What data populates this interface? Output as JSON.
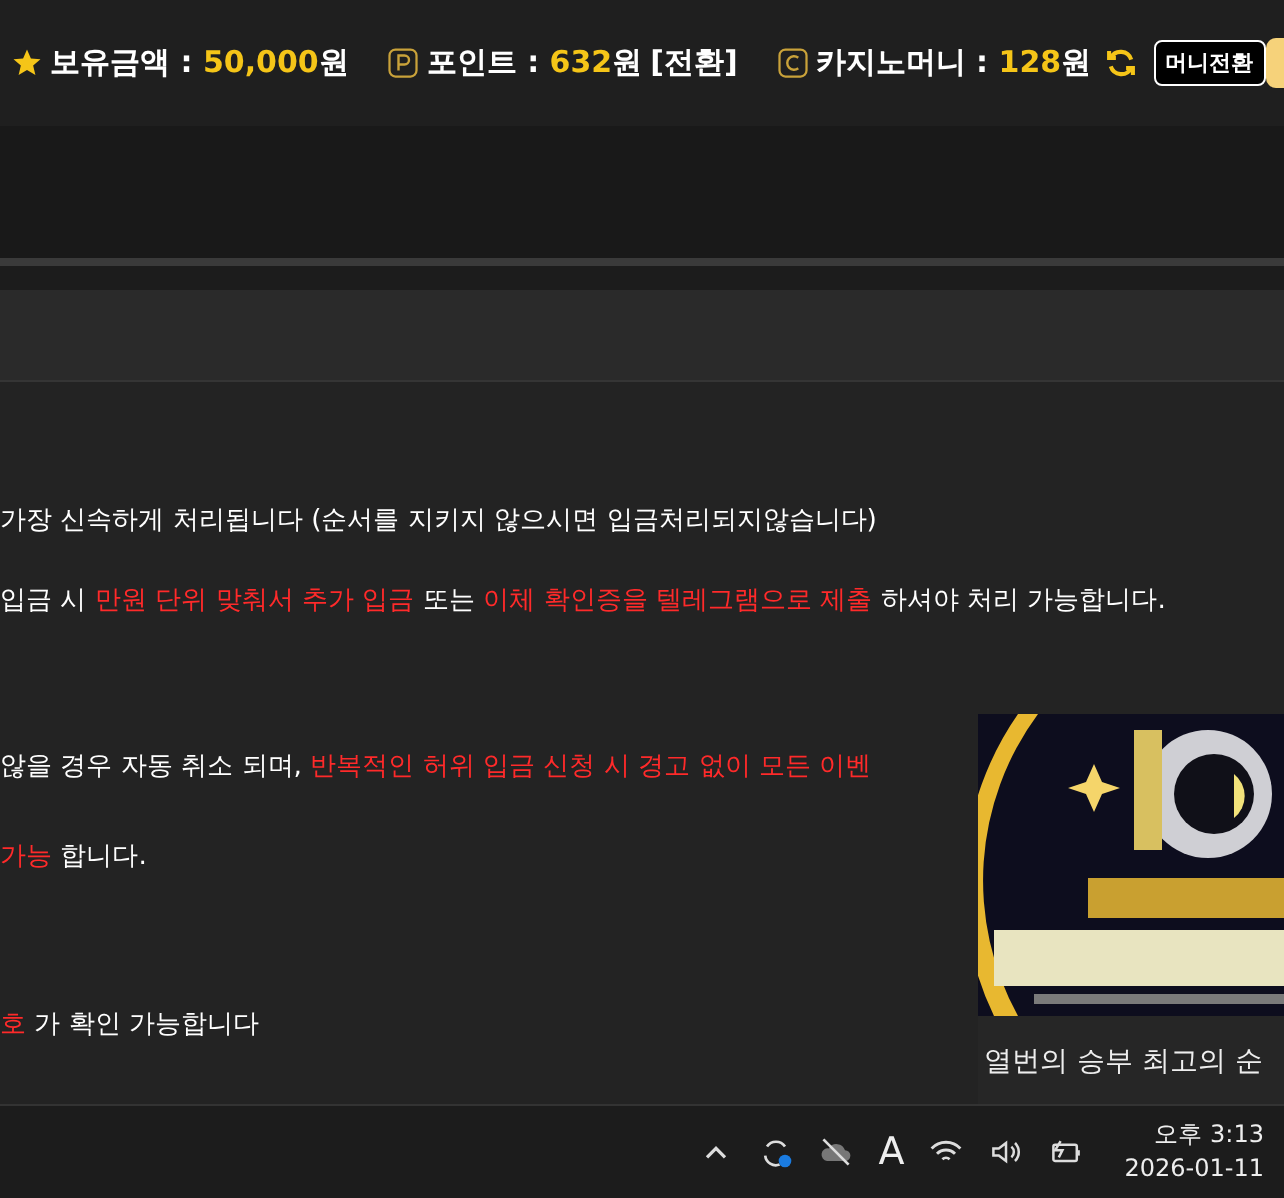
{
  "top_bar": {
    "balance": {
      "label": "보유금액 : ",
      "amount": "50,000",
      "unit": "원"
    },
    "points": {
      "label": "포인트 : ",
      "amount": "632",
      "unit": "원",
      "action": "[전환]"
    },
    "casino_money": {
      "label": "카지노머니 : ",
      "amount": "128",
      "unit": "원"
    },
    "exchange_button": "머니전환"
  },
  "notices": [
    {
      "segments": [
        {
          "text": "가장 신속하게 처리됩니다 (순서를 지키지 않으시면 입금처리되지않습니다)",
          "highlight": false
        }
      ]
    },
    {
      "segments": [
        {
          "text": "입금 시 ",
          "highlight": false
        },
        {
          "text": "만원 단위 맞춰서 추가 입금",
          "highlight": true
        },
        {
          "text": " 또는 ",
          "highlight": false
        },
        {
          "text": "이체 확인증을 텔레그램으로 제출",
          "highlight": true
        },
        {
          "text": " 하셔야 처리 가능합니다.",
          "highlight": false
        }
      ]
    },
    {
      "segments": [
        {
          "text": "않을 경우 자동 취소 되며, ",
          "highlight": false
        },
        {
          "text": "반복적인 허위 입금 신청 시 경고 없이 모든 이벤",
          "highlight": true
        }
      ]
    },
    {
      "segments": [
        {
          "text": "가능",
          "highlight": true
        },
        {
          "text": " 합니다.",
          "highlight": false
        }
      ]
    },
    {
      "segments": [
        {
          "text": "호",
          "highlight": true
        },
        {
          "text": " 가 확인 가능합니다",
          "highlight": false
        }
      ]
    }
  ],
  "popup": {
    "caption": "열번의 승부 최고의 순"
  },
  "taskbar": {
    "ime": "A",
    "time": "오후 3:13",
    "date": "2026-01-11"
  }
}
